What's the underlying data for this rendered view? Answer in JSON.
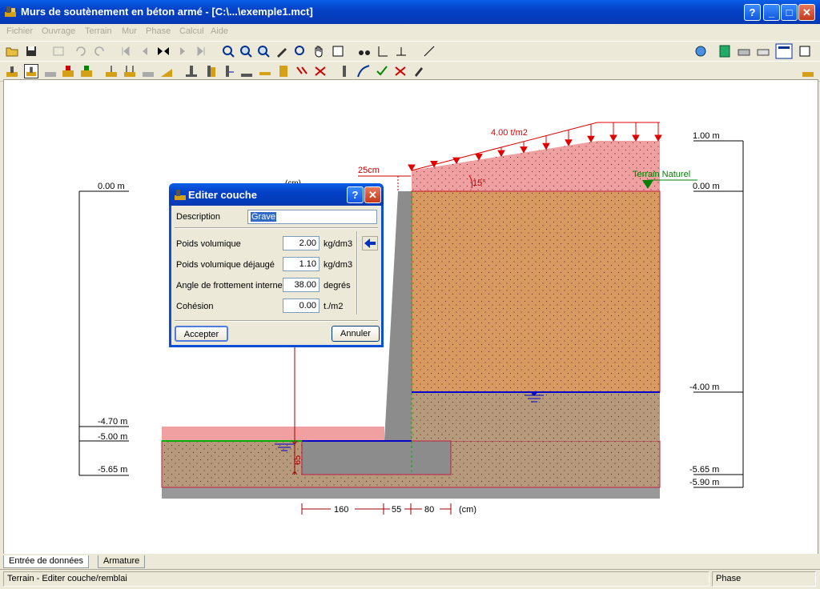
{
  "window": {
    "title": "Murs de soutènement en béton armé - [C:\\...\\exemple1.mct]",
    "help_btn": "?",
    "min_btn": "_",
    "max_btn": "□",
    "close_btn": "✕"
  },
  "menu": [
    "Fichier",
    "Ouvrage",
    "Terrain",
    "Mur",
    "Phase",
    "Calcul",
    "Aide"
  ],
  "drawing": {
    "load_label": "4.00 t/m2",
    "wall_top_label": "25cm",
    "slope_label": "15°",
    "terrain_label": "Terrain Naturel",
    "cm_label_top": "(cm)",
    "dims_bottom": [
      "160",
      "55",
      "80",
      "(cm)"
    ],
    "heel_dim": "65",
    "levels_left": [
      "0.00 m",
      "-4.70 m",
      "-5.00 m",
      "-5.65 m"
    ],
    "levels_right": [
      "1.00 m",
      "0.00 m",
      "-4.00 m",
      "-5.65 m",
      "-5.90 m"
    ],
    "colors": {
      "layer_top": "#d99a62",
      "layer_bottom": "#b69a7c",
      "fill_pink": "#f0a0a0",
      "wall": "#8c8c8c",
      "water": "#0000c8",
      "load": "#e00000",
      "terrain": "#008000"
    }
  },
  "dialog": {
    "title": "Editer couche",
    "help": "?",
    "close": "✕",
    "description_label": "Description",
    "description_value": "Grave",
    "rows": [
      {
        "label": "Poids volumique",
        "value": "2.00",
        "unit": "kg/dm3"
      },
      {
        "label": "Poids volumique déjaugé",
        "value": "1.10",
        "unit": "kg/dm3"
      },
      {
        "label": "Angle de frottement interne",
        "value": "38.00",
        "unit": "degrés"
      },
      {
        "label": "Cohésion",
        "value": "0.00",
        "unit": "t./m2"
      }
    ],
    "accept": "Accepter",
    "cancel": "Annuler"
  },
  "tabs": [
    "Entrée de données",
    "Armature"
  ],
  "status": {
    "left": "Terrain - Editer couche/remblai",
    "right": "Phase"
  }
}
